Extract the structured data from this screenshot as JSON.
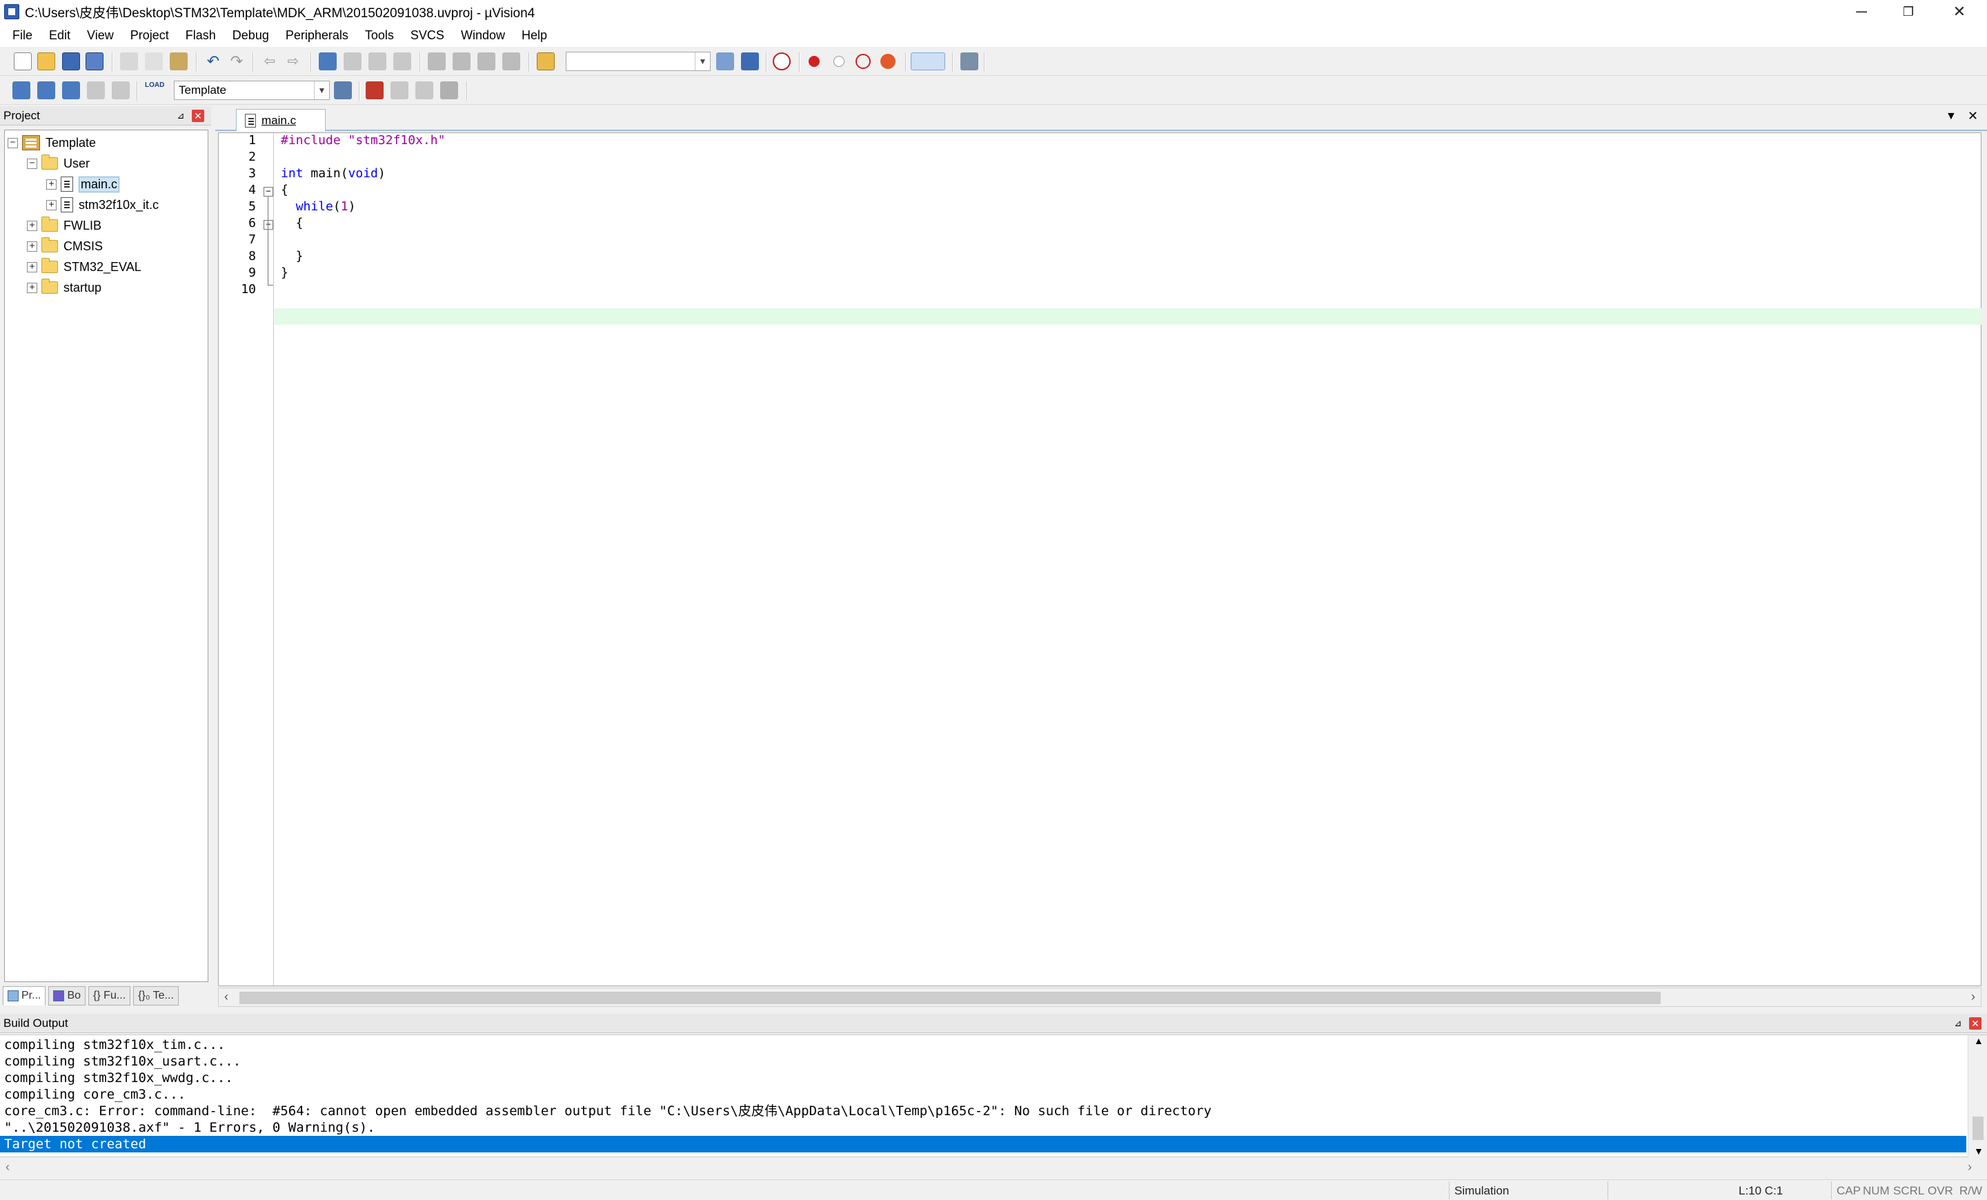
{
  "window": {
    "title": "C:\\Users\\皮皮伟\\Desktop\\STM32\\Template\\MDK_ARM\\201502091038.uvproj - µVision4",
    "minimize": "─",
    "restore": "❐",
    "close": "✕"
  },
  "menu": [
    "File",
    "Edit",
    "View",
    "Project",
    "Flash",
    "Debug",
    "Peripherals",
    "Tools",
    "SVCS",
    "Window",
    "Help"
  ],
  "toolbar2": {
    "target_combo": "Template",
    "load_label": "LOAD"
  },
  "project_panel": {
    "title": "Project",
    "pin": "⊿",
    "close": "✕",
    "tree": {
      "root": "Template",
      "user": "User",
      "file1": "main.c",
      "file2": "stm32f10x_it.c",
      "group1": "FWLIB",
      "group2": "CMSIS",
      "group3": "STM32_EVAL",
      "group4": "startup"
    },
    "tabs": [
      "Pr...",
      "Bo",
      "{} Fu...",
      "{}₀ Te..."
    ]
  },
  "editor": {
    "tab_label": "main.c",
    "line_numbers": [
      "1",
      "2",
      "3",
      "4",
      "5",
      "6",
      "7",
      "8",
      "9",
      "10"
    ],
    "cursor_line": 10
  },
  "build_output": {
    "title": "Build Output",
    "lines": [
      "compiling stm32f10x_tim.c...",
      "compiling stm32f10x_usart.c...",
      "compiling stm32f10x_wwdg.c...",
      "compiling core_cm3.c...",
      "core_cm3.c: Error: command-line:  #564: cannot open embedded assembler output file \"C:\\Users\\皮皮伟\\AppData\\Local\\Temp\\p165c-2\": No such file or directory",
      "\"..\\201502091038.axf\" - 1 Errors, 0 Warning(s)."
    ],
    "selected_line": "Target not created"
  },
  "statusbar": {
    "mode": "Simulation",
    "position": "L:10 C:1",
    "cap": "CAP",
    "num": "NUM",
    "scrl": "SCRL",
    "ovr": "OVR",
    "rw": "R/W"
  },
  "colors": {
    "keyword": "#0000ff",
    "preprocessor": "#a000a0",
    "current_line": "#e2fbe6",
    "selection": "#0078d7"
  }
}
